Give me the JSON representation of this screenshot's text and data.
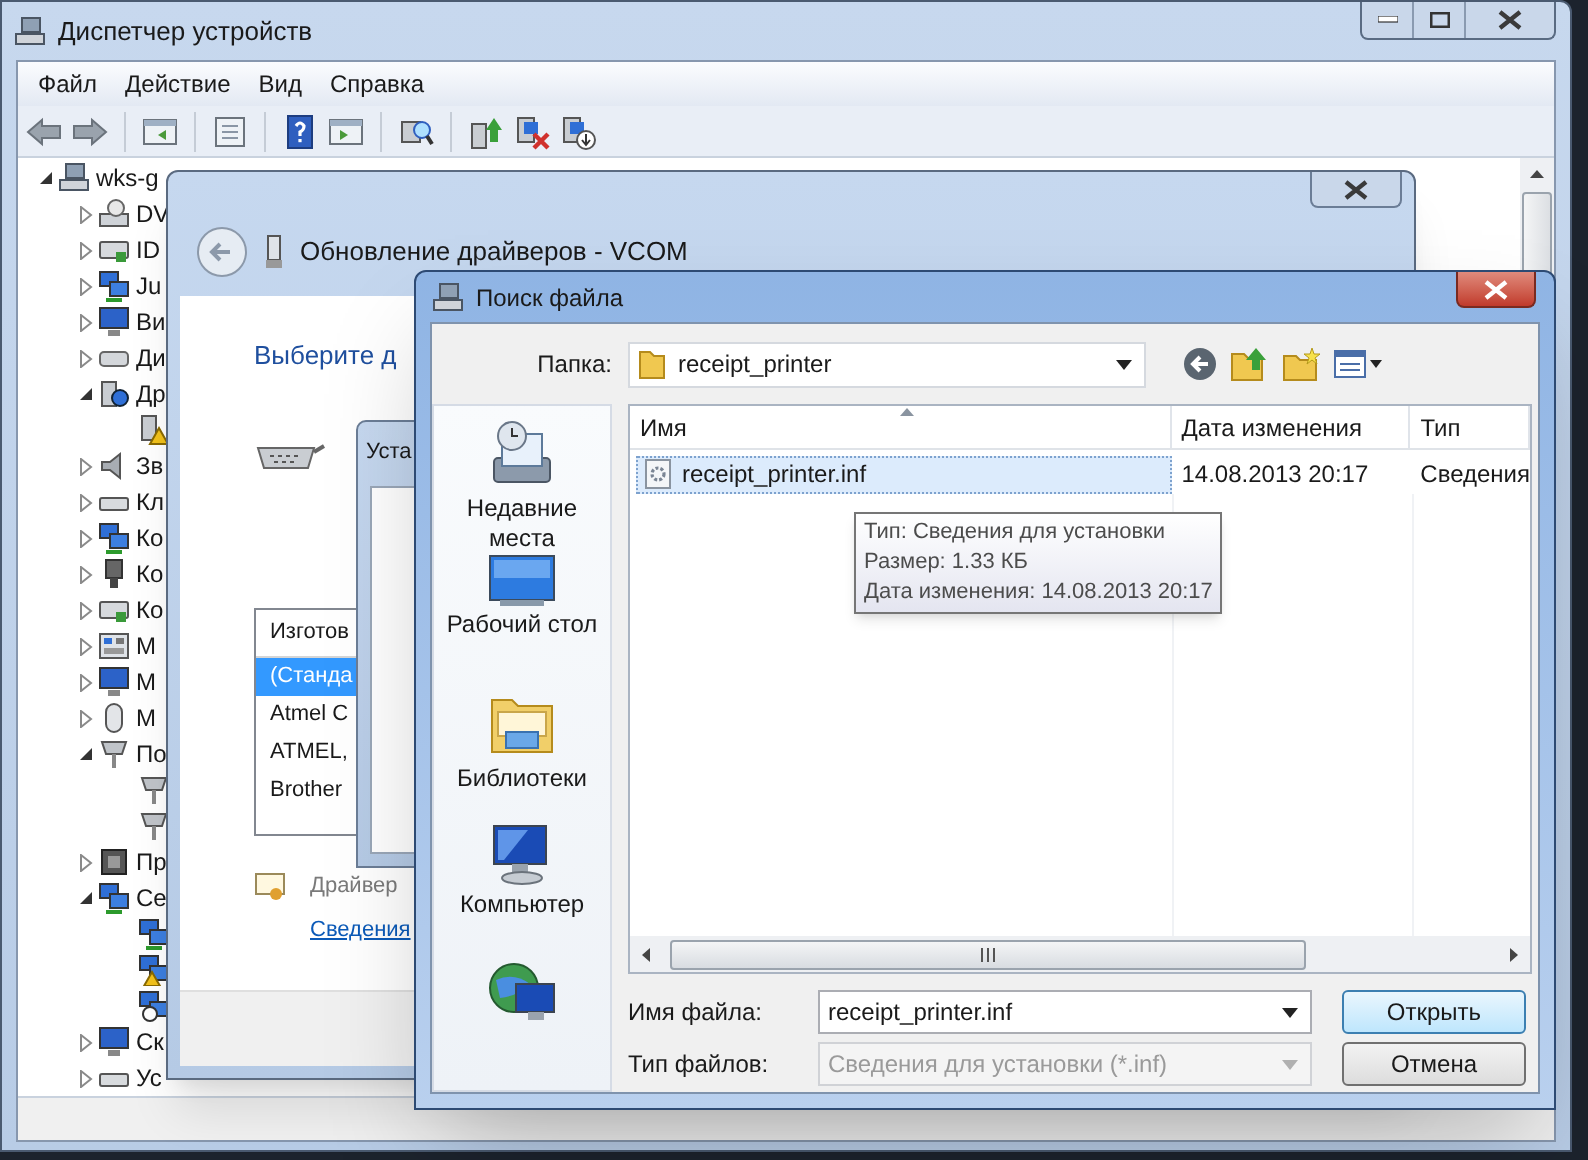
{
  "device_manager": {
    "title": "Диспетчер устройств",
    "menu": [
      "Файл",
      "Действие",
      "Вид",
      "Справка"
    ],
    "tree": {
      "label": "wks-g",
      "kind": "computer",
      "expanded": true,
      "children": [
        {
          "label": "DV",
          "kind": "disc",
          "expanded": false
        },
        {
          "label": "ID",
          "kind": "controller",
          "expanded": false
        },
        {
          "label": "Ju",
          "kind": "network",
          "expanded": false
        },
        {
          "label": "Ви",
          "kind": "monitor",
          "expanded": false
        },
        {
          "label": "Ди",
          "kind": "drive",
          "expanded": false
        },
        {
          "label": "Др",
          "kind": "unknown",
          "expanded": true,
          "children": [
            {
              "kind": "warning"
            }
          ]
        },
        {
          "label": "Зв",
          "kind": "speaker",
          "expanded": false
        },
        {
          "label": "Кл",
          "kind": "keyboard",
          "expanded": false
        },
        {
          "label": "Ко",
          "kind": "network",
          "expanded": false
        },
        {
          "label": "Ко",
          "kind": "plug",
          "expanded": false
        },
        {
          "label": "Ко",
          "kind": "controller",
          "expanded": false
        },
        {
          "label": "М",
          "kind": "modem",
          "expanded": false
        },
        {
          "label": "М",
          "kind": "monitor",
          "expanded": false
        },
        {
          "label": "М",
          "kind": "mouse",
          "expanded": false
        },
        {
          "label": "По",
          "kind": "port",
          "expanded": true,
          "children": [
            {
              "kind": "port"
            },
            {
              "kind": "port"
            }
          ]
        },
        {
          "label": "Пр",
          "kind": "chip",
          "expanded": false
        },
        {
          "label": "Се",
          "kind": "network",
          "expanded": true,
          "children": [
            {
              "kind": "network"
            },
            {
              "kind": "network-warning"
            },
            {
              "kind": "network-down"
            }
          ]
        },
        {
          "label": "Ск",
          "kind": "monitor",
          "expanded": false
        },
        {
          "label": "Ус",
          "kind": "keyboard",
          "expanded": false
        }
      ]
    }
  },
  "wizard": {
    "title": "Обновление драйверов - VCOM",
    "heading": "Выберите д",
    "list": {
      "header": "Изготов",
      "items": [
        {
          "label": "(Станда",
          "selected": true
        },
        {
          "label": "Atmel C",
          "selected": false
        },
        {
          "label": "ATMEL,",
          "selected": false
        },
        {
          "label": "Brother",
          "selected": false
        }
      ]
    },
    "note": "Драйвер",
    "link": "Сведения"
  },
  "install_dialog": {
    "title": "Уста"
  },
  "file_dialog": {
    "title": "Поиск файла",
    "folder_label": "Папка:",
    "folder": "receipt_printer",
    "places": [
      {
        "label": "Недавние места",
        "kind": "recent"
      },
      {
        "label": "Рабочий стол",
        "kind": "desktop"
      },
      {
        "label": "Библиотеки",
        "kind": "libraries"
      },
      {
        "label": "Компьютер",
        "kind": "computer"
      },
      {
        "kind": "network"
      }
    ],
    "columns": [
      {
        "label": "Имя",
        "sorted": true
      },
      {
        "label": "Дата изменения",
        "sorted": false
      },
      {
        "label": "Тип",
        "sorted": false
      }
    ],
    "rows": [
      {
        "name": "receipt_printer.inf",
        "date": "14.08.2013 20:17",
        "type": "Сведения",
        "selected": true
      }
    ],
    "tooltip": [
      "Тип: Сведения для установки",
      "Размер: 1.33 КБ",
      "Дата изменения: 14.08.2013 20:17"
    ],
    "file_name": {
      "label": "Имя файла:",
      "value": "receipt_printer.inf"
    },
    "file_type": {
      "label": "Тип файлов:",
      "value": "Сведения для установки (*.inf)",
      "disabled": true
    },
    "buttons": [
      {
        "label": "Открыть",
        "default": true
      },
      {
        "label": "Отмена",
        "default": false
      }
    ]
  }
}
